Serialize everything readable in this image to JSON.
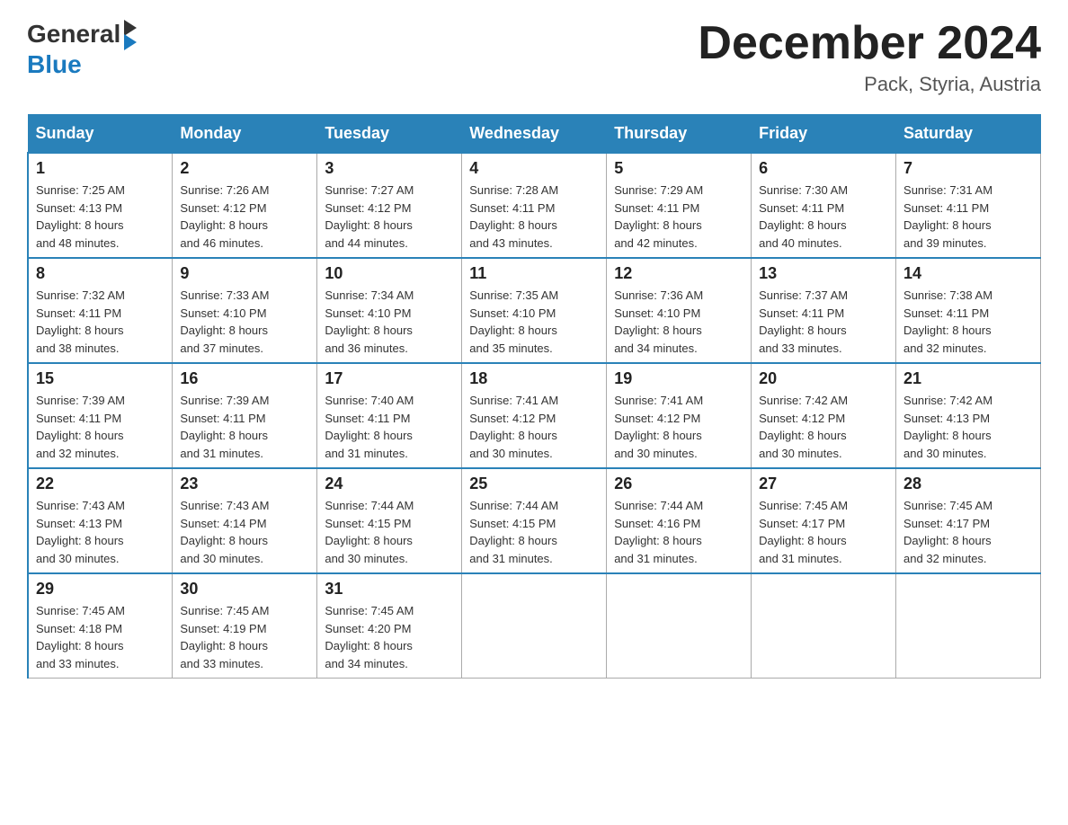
{
  "header": {
    "logo": {
      "general": "General",
      "blue": "Blue"
    },
    "title": "December 2024",
    "location": "Pack, Styria, Austria"
  },
  "days_of_week": [
    "Sunday",
    "Monday",
    "Tuesday",
    "Wednesday",
    "Thursday",
    "Friday",
    "Saturday"
  ],
  "weeks": [
    [
      {
        "day": "1",
        "sunrise": "7:25 AM",
        "sunset": "4:13 PM",
        "daylight": "8 hours and 48 minutes."
      },
      {
        "day": "2",
        "sunrise": "7:26 AM",
        "sunset": "4:12 PM",
        "daylight": "8 hours and 46 minutes."
      },
      {
        "day": "3",
        "sunrise": "7:27 AM",
        "sunset": "4:12 PM",
        "daylight": "8 hours and 44 minutes."
      },
      {
        "day": "4",
        "sunrise": "7:28 AM",
        "sunset": "4:11 PM",
        "daylight": "8 hours and 43 minutes."
      },
      {
        "day": "5",
        "sunrise": "7:29 AM",
        "sunset": "4:11 PM",
        "daylight": "8 hours and 42 minutes."
      },
      {
        "day": "6",
        "sunrise": "7:30 AM",
        "sunset": "4:11 PM",
        "daylight": "8 hours and 40 minutes."
      },
      {
        "day": "7",
        "sunrise": "7:31 AM",
        "sunset": "4:11 PM",
        "daylight": "8 hours and 39 minutes."
      }
    ],
    [
      {
        "day": "8",
        "sunrise": "7:32 AM",
        "sunset": "4:11 PM",
        "daylight": "8 hours and 38 minutes."
      },
      {
        "day": "9",
        "sunrise": "7:33 AM",
        "sunset": "4:10 PM",
        "daylight": "8 hours and 37 minutes."
      },
      {
        "day": "10",
        "sunrise": "7:34 AM",
        "sunset": "4:10 PM",
        "daylight": "8 hours and 36 minutes."
      },
      {
        "day": "11",
        "sunrise": "7:35 AM",
        "sunset": "4:10 PM",
        "daylight": "8 hours and 35 minutes."
      },
      {
        "day": "12",
        "sunrise": "7:36 AM",
        "sunset": "4:10 PM",
        "daylight": "8 hours and 34 minutes."
      },
      {
        "day": "13",
        "sunrise": "7:37 AM",
        "sunset": "4:11 PM",
        "daylight": "8 hours and 33 minutes."
      },
      {
        "day": "14",
        "sunrise": "7:38 AM",
        "sunset": "4:11 PM",
        "daylight": "8 hours and 32 minutes."
      }
    ],
    [
      {
        "day": "15",
        "sunrise": "7:39 AM",
        "sunset": "4:11 PM",
        "daylight": "8 hours and 32 minutes."
      },
      {
        "day": "16",
        "sunrise": "7:39 AM",
        "sunset": "4:11 PM",
        "daylight": "8 hours and 31 minutes."
      },
      {
        "day": "17",
        "sunrise": "7:40 AM",
        "sunset": "4:11 PM",
        "daylight": "8 hours and 31 minutes."
      },
      {
        "day": "18",
        "sunrise": "7:41 AM",
        "sunset": "4:12 PM",
        "daylight": "8 hours and 30 minutes."
      },
      {
        "day": "19",
        "sunrise": "7:41 AM",
        "sunset": "4:12 PM",
        "daylight": "8 hours and 30 minutes."
      },
      {
        "day": "20",
        "sunrise": "7:42 AM",
        "sunset": "4:12 PM",
        "daylight": "8 hours and 30 minutes."
      },
      {
        "day": "21",
        "sunrise": "7:42 AM",
        "sunset": "4:13 PM",
        "daylight": "8 hours and 30 minutes."
      }
    ],
    [
      {
        "day": "22",
        "sunrise": "7:43 AM",
        "sunset": "4:13 PM",
        "daylight": "8 hours and 30 minutes."
      },
      {
        "day": "23",
        "sunrise": "7:43 AM",
        "sunset": "4:14 PM",
        "daylight": "8 hours and 30 minutes."
      },
      {
        "day": "24",
        "sunrise": "7:44 AM",
        "sunset": "4:15 PM",
        "daylight": "8 hours and 30 minutes."
      },
      {
        "day": "25",
        "sunrise": "7:44 AM",
        "sunset": "4:15 PM",
        "daylight": "8 hours and 31 minutes."
      },
      {
        "day": "26",
        "sunrise": "7:44 AM",
        "sunset": "4:16 PM",
        "daylight": "8 hours and 31 minutes."
      },
      {
        "day": "27",
        "sunrise": "7:45 AM",
        "sunset": "4:17 PM",
        "daylight": "8 hours and 31 minutes."
      },
      {
        "day": "28",
        "sunrise": "7:45 AM",
        "sunset": "4:17 PM",
        "daylight": "8 hours and 32 minutes."
      }
    ],
    [
      {
        "day": "29",
        "sunrise": "7:45 AM",
        "sunset": "4:18 PM",
        "daylight": "8 hours and 33 minutes."
      },
      {
        "day": "30",
        "sunrise": "7:45 AM",
        "sunset": "4:19 PM",
        "daylight": "8 hours and 33 minutes."
      },
      {
        "day": "31",
        "sunrise": "7:45 AM",
        "sunset": "4:20 PM",
        "daylight": "8 hours and 34 minutes."
      },
      null,
      null,
      null,
      null
    ]
  ],
  "labels": {
    "sunrise": "Sunrise:",
    "sunset": "Sunset:",
    "daylight": "Daylight:"
  }
}
